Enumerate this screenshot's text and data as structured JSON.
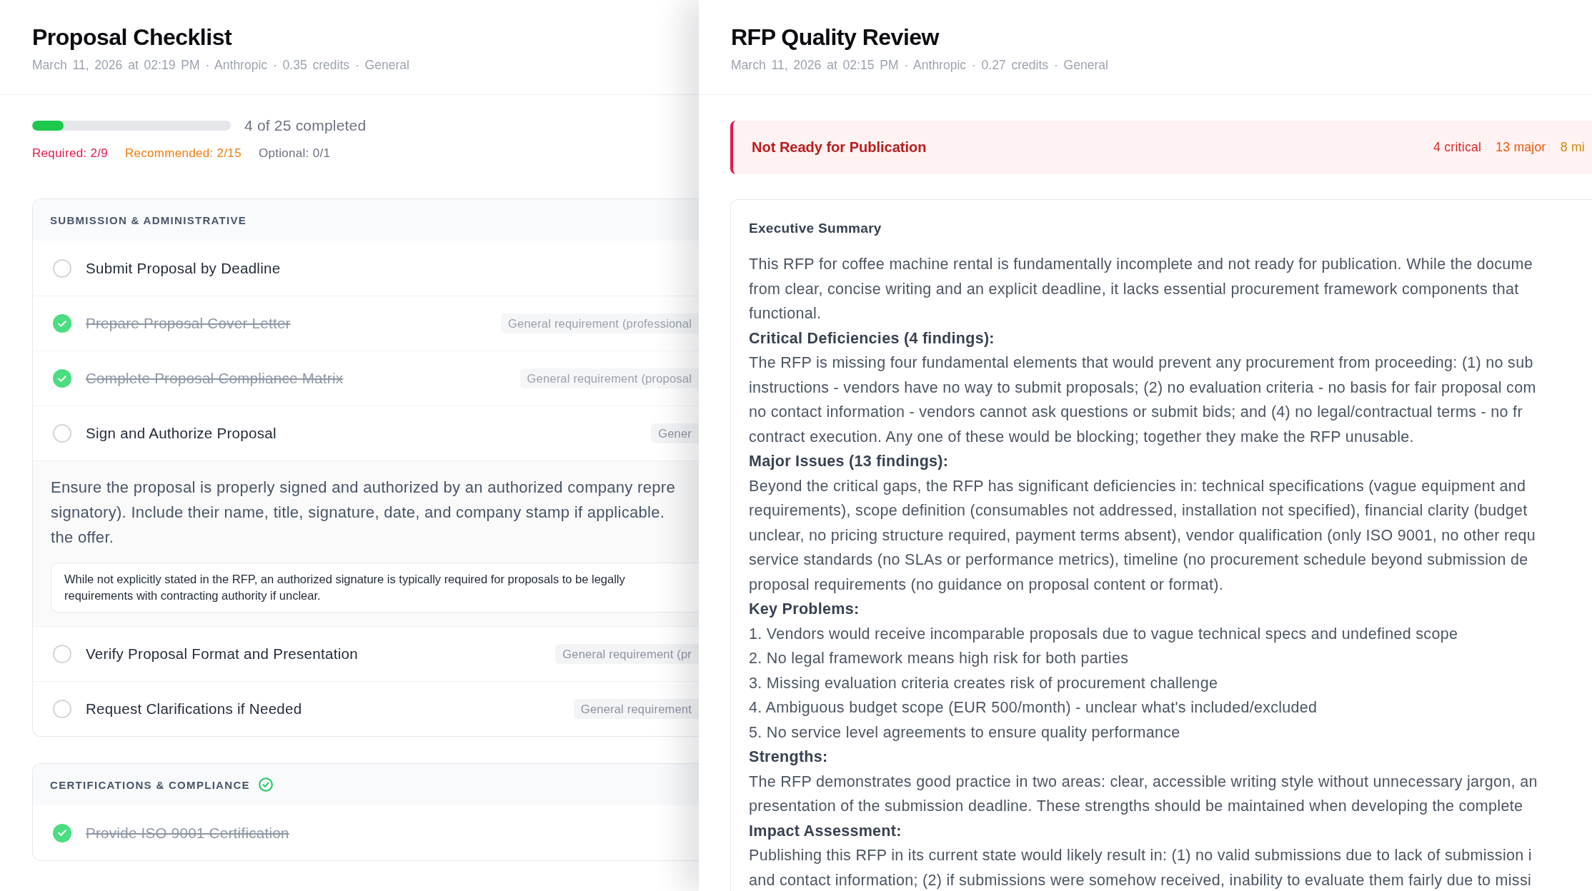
{
  "checklist_window": {
    "title": "Proposal Checklist",
    "meta": "March 11, 2026 at 02:19 PM · Anthropic · 0.35 credits · General",
    "progress": {
      "level": 0.16,
      "label": "4 of 25 completed"
    },
    "breakdown": [
      {
        "label": "Required: 2/9",
        "color": "#e8174a"
      },
      {
        "label": "Recommended: 2/15",
        "color": "#f07c0c"
      },
      {
        "label": "Optional: 0/1",
        "color": "#6b7280"
      }
    ],
    "sections": [
      {
        "title": "SUBMISSION & ADMINISTRATIVE",
        "complete": false,
        "items": [
          {
            "title": "Submit Proposal by Deadline",
            "checked": false,
            "expanded": false
          },
          {
            "title": "Prepare Proposal Cover Letter",
            "checked": true,
            "expanded": false,
            "tag": "General requirement (professional"
          },
          {
            "title": "Complete Proposal Compliance Matrix",
            "checked": true,
            "expanded": false,
            "tag": "General requirement (proposal"
          },
          {
            "title": "Sign and Authorize Proposal",
            "checked": false,
            "expanded": true,
            "tag": "Gener",
            "description": [
              "Ensure the proposal is properly signed and authorized by an authorized company repre",
              "signatory). Include their name, title, signature, date, and company stamp if applicable.",
              "the offer."
            ],
            "note": [
              "While not explicitly stated in the RFP, an authorized signature is typically required for proposals to be legally",
              "requirements with contracting authority if unclear."
            ]
          },
          {
            "title": "Verify Proposal Format and Presentation",
            "checked": false,
            "expanded": false,
            "tag": "General requirement (pr"
          },
          {
            "title": "Request Clarifications if Needed",
            "checked": false,
            "expanded": false,
            "tag": "General requirement"
          }
        ]
      },
      {
        "title": "CERTIFICATIONS & COMPLIANCE",
        "complete": true,
        "items": [
          {
            "title": "Provide ISO 9001 Certification",
            "checked": true,
            "expanded": false
          }
        ]
      }
    ]
  },
  "review_window": {
    "title": "RFP Quality Review",
    "meta": "March 11, 2026 at 02:15 PM · Anthropic · 0.27 credits · General",
    "verdict": {
      "title": "Not Ready for Publication",
      "counts": [
        {
          "label": "4 critical",
          "color": "#dc2626"
        },
        {
          "label": "13 major",
          "color": "#ea580c"
        },
        {
          "label": "8 mi",
          "color": "#ca8a04"
        }
      ]
    },
    "summary": {
      "heading": "Executive Summary",
      "blocks": [
        {
          "kind": "paragraph",
          "lines": [
            "This RFP for coffee machine rental is fundamentally incomplete and not ready for publication. While the docume",
            "from clear, concise writing and an explicit deadline, it lacks essential procurement framework components that",
            "functional."
          ]
        },
        {
          "kind": "heading",
          "text": "Critical Deficiencies (4 findings):"
        },
        {
          "kind": "paragraph",
          "lines": [
            "The RFP is missing four fundamental elements that would prevent any procurement from proceeding: (1) no sub",
            "instructions - vendors have no way to submit proposals; (2) no evaluation criteria - no basis for fair proposal com",
            "no contact information - vendors cannot ask questions or submit bids; and (4) no legal/contractual terms - no fr",
            "contract execution. Any one of these would be blocking; together they make the RFP unusable."
          ]
        },
        {
          "kind": "heading",
          "text": "Major Issues (13 findings):"
        },
        {
          "kind": "paragraph",
          "lines": [
            "Beyond the critical gaps, the RFP has significant deficiencies in: technical specifications (vague equipment and",
            "requirements), scope definition (consumables not addressed, installation not specified), financial clarity (budget",
            "unclear, no pricing structure required, payment terms absent), vendor qualification (only ISO 9001, no other requ",
            "service standards (no SLAs or performance metrics), timeline (no procurement schedule beyond submission de",
            "proposal requirements (no guidance on proposal content or format)."
          ]
        },
        {
          "kind": "heading",
          "text": "Key Problems:"
        },
        {
          "kind": "list_item",
          "text": "1. Vendors would receive incomparable proposals due to vague technical specs and undefined scope"
        },
        {
          "kind": "list_item",
          "text": "2. No legal framework means high risk for both parties"
        },
        {
          "kind": "list_item",
          "text": "3. Missing evaluation criteria creates risk of procurement challenge"
        },
        {
          "kind": "list_item",
          "text": "4. Ambiguous budget scope (EUR 500/month) - unclear what's included/excluded"
        },
        {
          "kind": "list_item",
          "text": "5. No service level agreements to ensure quality performance"
        },
        {
          "kind": "heading",
          "text": "Strengths:"
        },
        {
          "kind": "paragraph",
          "lines": [
            "The RFP demonstrates good practice in two areas: clear, accessible writing style without unnecessary jargon, an",
            "presentation of the submission deadline. These strengths should be maintained when developing the complete"
          ]
        },
        {
          "kind": "heading",
          "text": "Impact Assessment:"
        },
        {
          "kind": "paragraph",
          "lines": [
            "Publishing this RFP in its current state would likely result in: (1) no valid submissions due to lack of submission i",
            "and contact information; (2) if submissions were somehow received, inability to evaluate them fairly due to missi"
          ]
        }
      ]
    }
  }
}
